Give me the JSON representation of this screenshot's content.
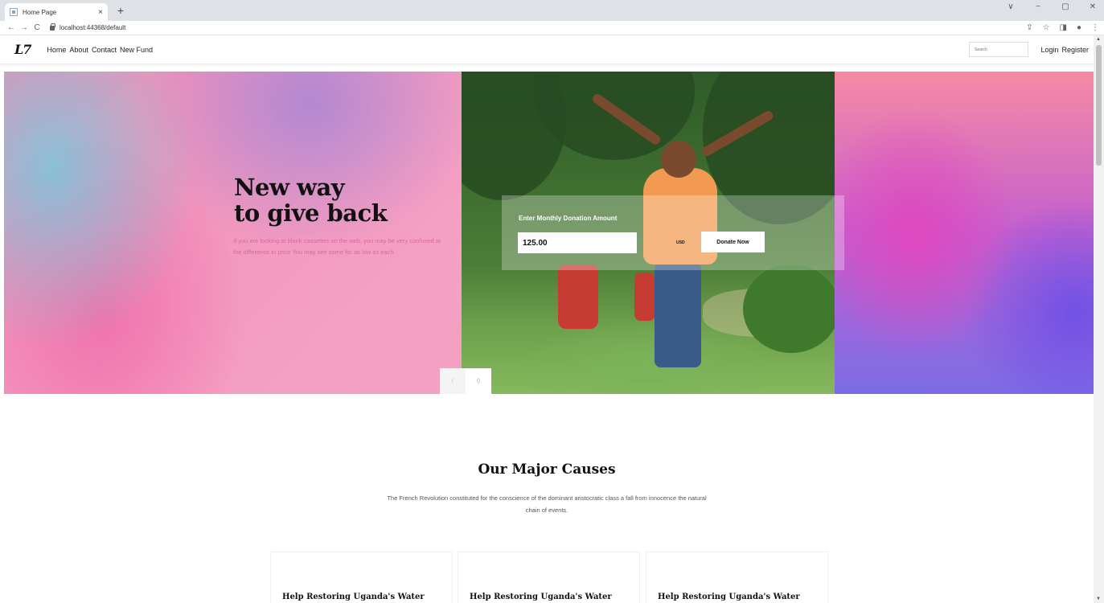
{
  "browser": {
    "tab_title": "Home Page",
    "tab_close": "×",
    "new_tab": "+",
    "url": "localhost:44368/default",
    "nav_back": "←",
    "nav_forward": "→",
    "nav_reload": "C",
    "window_controls": [
      "∨",
      "−",
      "▢",
      "✕"
    ],
    "toolbar_icons": [
      "⇪",
      "☆",
      "◨",
      "●",
      "⋮"
    ]
  },
  "site": {
    "logo": "L7",
    "nav": [
      "Home",
      "About",
      "Contact",
      "New Fund"
    ],
    "search_placeholder": "Search",
    "auth": [
      "Login",
      "Register"
    ]
  },
  "hero": {
    "title_line1": "New way",
    "title_line2": "to give back",
    "text": "If you are looking at blank cassettes on the web, you may be very confused at the difference in price You may see some for as low as each.",
    "donation_label": "Enter Monthly Donation Amount",
    "donation_value": "125.00",
    "currency": "USD",
    "donate_button": "Donate Now",
    "carousel_prev": "(",
    "carousel_next": "()"
  },
  "causes": {
    "title": "Our Major Causes",
    "description": "The French Revolution constituted for the conscience of the dominant aristocratic class a fall from innocence the natural chain of events.",
    "cards": [
      {
        "title": "Help Restoring Uganda's Water"
      },
      {
        "title": "Help Restoring Uganda's Water"
      },
      {
        "title": "Help Restoring Uganda's Water"
      }
    ]
  }
}
